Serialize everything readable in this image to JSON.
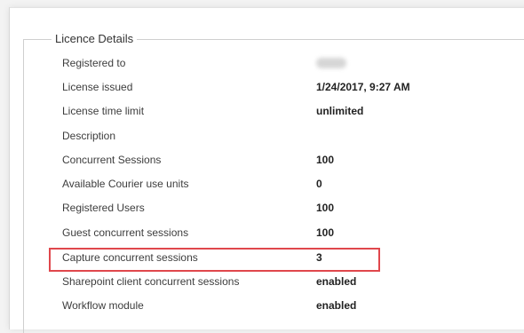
{
  "section": {
    "legend": "Licence Details"
  },
  "rows": [
    {
      "label": "Registered to",
      "value": ""
    },
    {
      "label": "License issued",
      "value": "1/24/2017, 9:27 AM"
    },
    {
      "label": "License time limit",
      "value": "unlimited"
    },
    {
      "label": "Description",
      "value": ""
    },
    {
      "label": "Concurrent Sessions",
      "value": "100"
    },
    {
      "label": "Available Courier use units",
      "value": "0"
    },
    {
      "label": "Registered Users",
      "value": "100"
    },
    {
      "label": "Guest concurrent sessions",
      "value": "100"
    },
    {
      "label": "Capture concurrent sessions",
      "value": "3"
    },
    {
      "label": "Sharepoint client concurrent sessions",
      "value": "enabled"
    },
    {
      "label": "Workflow module",
      "value": "enabled"
    }
  ],
  "highlight": {
    "color": "#e0474c",
    "row": "Capture concurrent sessions"
  }
}
